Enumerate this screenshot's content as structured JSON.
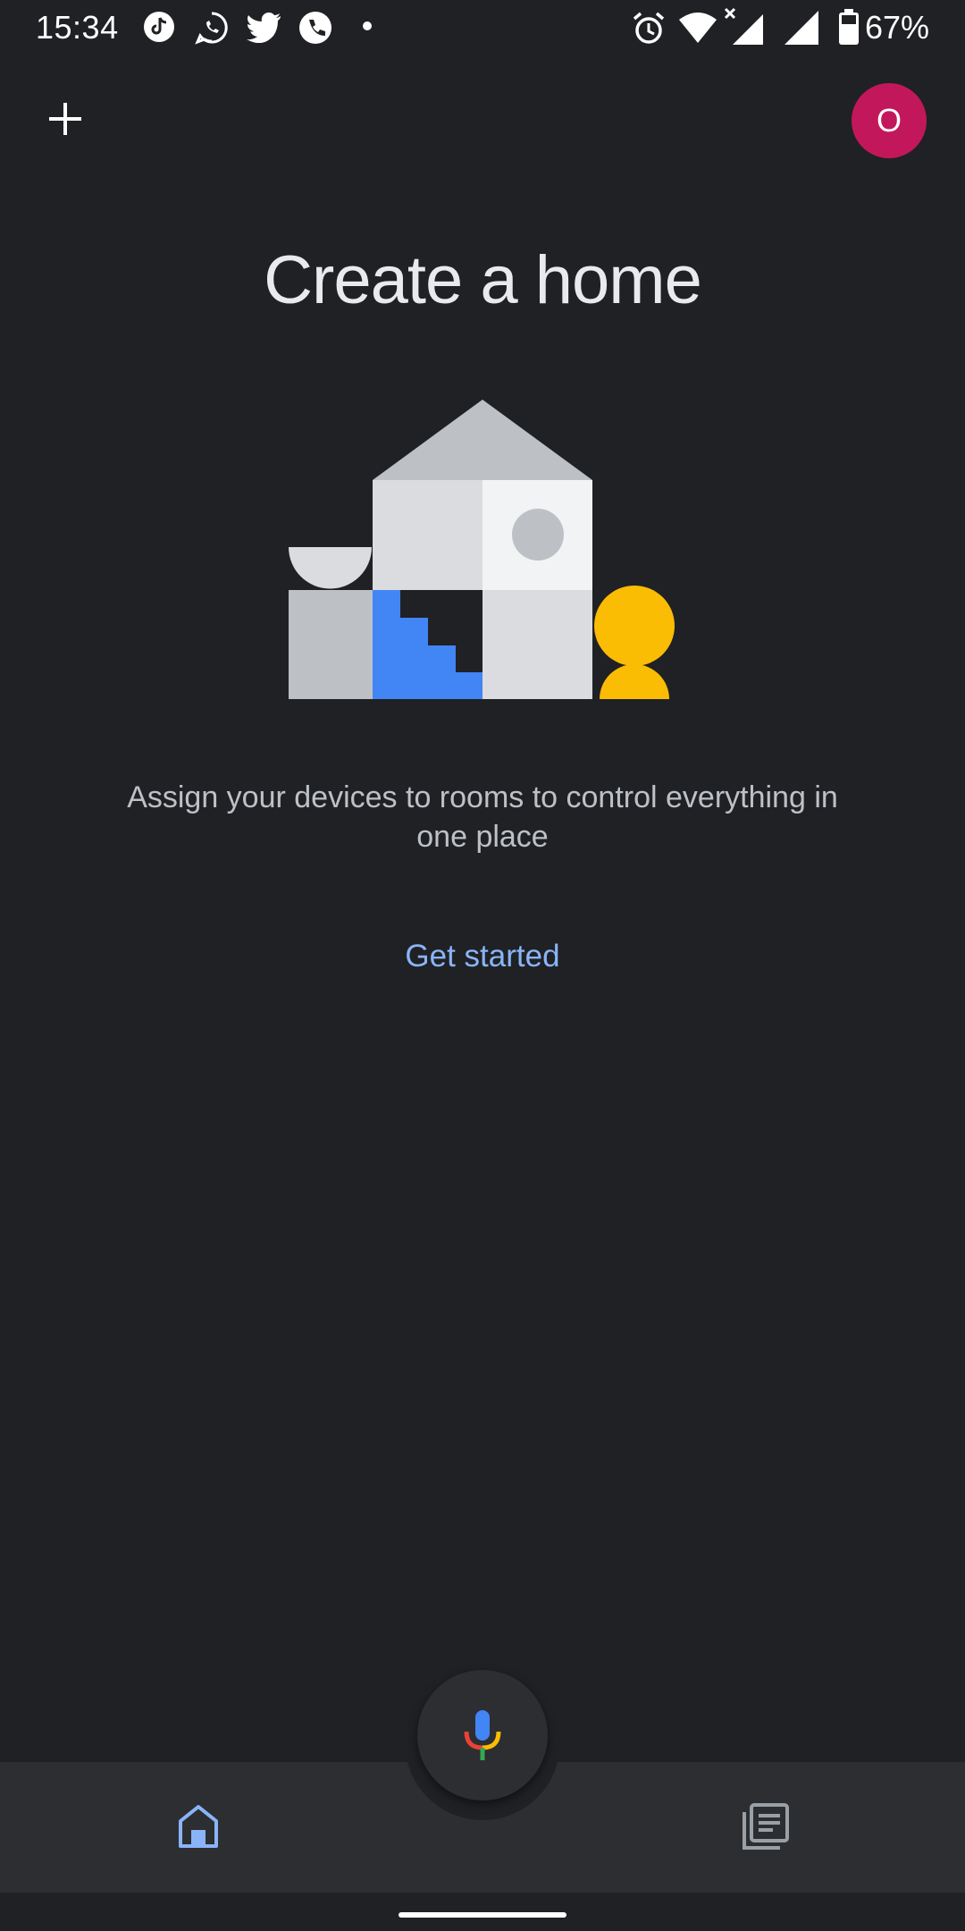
{
  "status_bar": {
    "time": "15:34",
    "battery": "67%",
    "notification_icons": [
      "tiktok-icon",
      "whatsapp-icon",
      "twitter-icon",
      "phone-icon",
      "dot-icon"
    ],
    "system_icons": [
      "alarm-icon",
      "wifi-icon",
      "signal-icon",
      "signal-icon",
      "battery-icon"
    ]
  },
  "top_bar": {
    "add_icon": "plus-icon",
    "avatar_initial": "O",
    "avatar_color": "#c2185b"
  },
  "empty_state": {
    "title": "Create a home",
    "description": "Assign your devices to rooms to control everything in one place",
    "action_label": "Get started",
    "action_color": "#8ab4f8"
  },
  "bottom_nav": {
    "fab_icon": "microphone-icon",
    "items": [
      {
        "icon": "home-icon",
        "active": true
      },
      {
        "icon": "feed-icon",
        "active": false
      }
    ]
  },
  "colors": {
    "background": "#202124",
    "surface": "#2d2e31",
    "accent_blue": "#4285f4",
    "accent_yellow": "#fbbc04"
  }
}
